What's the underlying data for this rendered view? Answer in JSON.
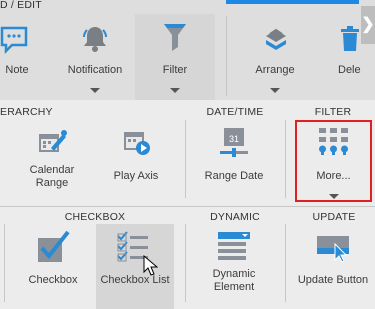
{
  "header": {
    "section_label": "D / EDIT",
    "scroll_arrow": "❯"
  },
  "top_tools": [
    {
      "label": "Note"
    },
    {
      "label": "Notification"
    },
    {
      "label": "Filter"
    },
    {
      "label": "Arrange"
    },
    {
      "label": "Dele"
    }
  ],
  "sections": {
    "hierarchy": "ERARCHY",
    "datetime": "DATE/TIME",
    "filter": "FILTER",
    "checkbox": "CHECKBOX",
    "dynamic": "DYNAMIC",
    "update": "UPDATE"
  },
  "mid_tools": {
    "calendar_range": "Calendar\nRange",
    "play_axis": "Play Axis",
    "range_date": "Range Date",
    "more": "More..."
  },
  "bottom_tools": {
    "checkbox": "Checkbox",
    "checkbox_list": "Checkbox List",
    "dynamic_element": "Dynamic\nElement",
    "update_button": "Update Button"
  },
  "colors": {
    "accent": "#1e88e5",
    "icon_blue": "#2a8ad4",
    "icon_gray": "#7a7f86",
    "highlight_red": "#e02020"
  }
}
